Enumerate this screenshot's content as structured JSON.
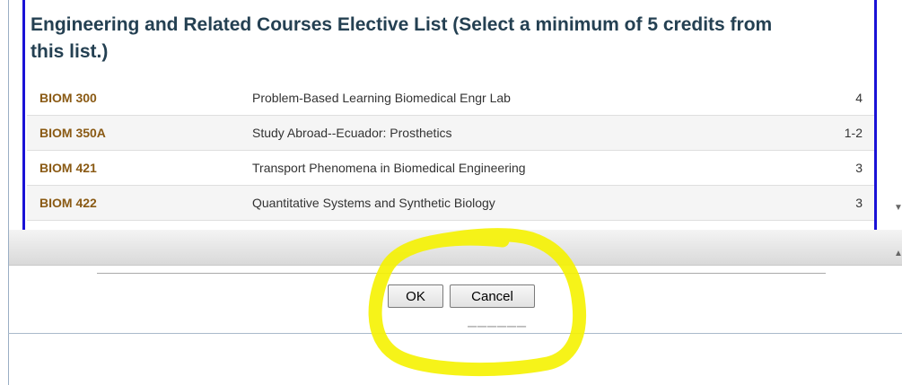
{
  "panel": {
    "heading_line1": "Engineering and Related Courses Elective List (Select a minimum of 5 credits from",
    "heading_line2": "this list.)"
  },
  "courses": [
    {
      "code": "BIOM 300",
      "title": "Problem-Based Learning Biomedical Engr Lab",
      "credits": "4"
    },
    {
      "code": "BIOM 350A",
      "title": "Study Abroad--Ecuador: Prosthetics",
      "credits": "1-2"
    },
    {
      "code": "BIOM 421",
      "title": "Transport Phenomena in Biomedical Engineering",
      "credits": "3"
    },
    {
      "code": "BIOM 422",
      "title": "Quantitative Systems and Synthetic Biology",
      "credits": "3"
    }
  ],
  "dialog": {
    "ok_label": "OK",
    "cancel_label": "Cancel"
  },
  "colors": {
    "panel_border": "#1a12d6",
    "heading": "#244052",
    "course_code": "#8a5a14",
    "highlight": "#f5f200"
  }
}
